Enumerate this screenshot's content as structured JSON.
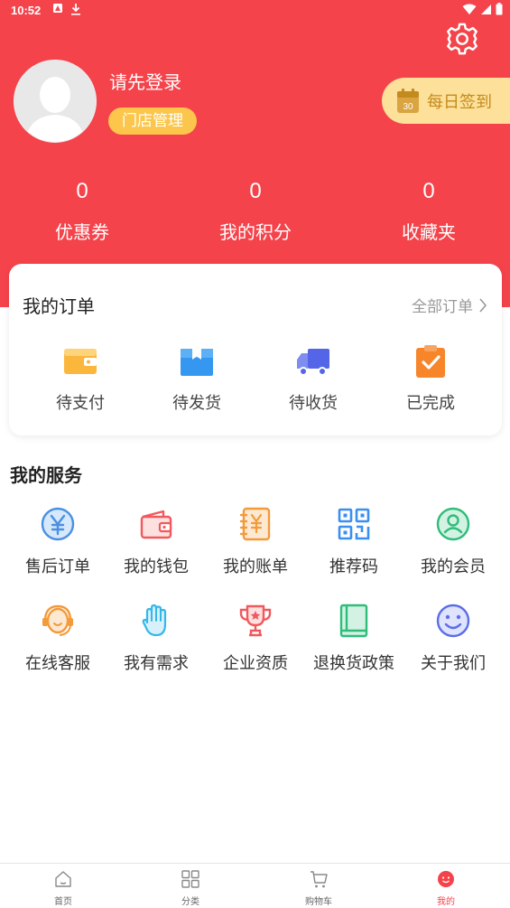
{
  "status_bar": {
    "time": "10:52"
  },
  "header": {
    "login_text": "请先登录",
    "store_button": "门店管理",
    "checkin_button": "每日签到",
    "checkin_day": "30",
    "stats": [
      {
        "value": "0",
        "label": "优惠券"
      },
      {
        "value": "0",
        "label": "我的积分"
      },
      {
        "value": "0",
        "label": "收藏夹"
      }
    ]
  },
  "orders": {
    "title": "我的订单",
    "all_link": "全部订单",
    "items": [
      {
        "label": "待支付",
        "icon": "wallet-icon",
        "color": "#fbb63c"
      },
      {
        "label": "待发货",
        "icon": "box-icon",
        "color": "#3597f0"
      },
      {
        "label": "待收货",
        "icon": "truck-icon",
        "color": "#5465e8"
      },
      {
        "label": "已完成",
        "icon": "clipboard-check-icon",
        "color": "#f7852a"
      }
    ]
  },
  "services": {
    "title": "我的服务",
    "items": [
      {
        "label": "售后订单",
        "icon": "yen-circle-icon",
        "color": "#4a90e2"
      },
      {
        "label": "我的钱包",
        "icon": "wallet-outline-icon",
        "color": "#f0595d"
      },
      {
        "label": "我的账单",
        "icon": "bill-icon",
        "color": "#f49a3b"
      },
      {
        "label": "推荐码",
        "icon": "qr-code-icon",
        "color": "#3b8ff0"
      },
      {
        "label": "我的会员",
        "icon": "member-icon",
        "color": "#2ebd7a"
      },
      {
        "label": "在线客服",
        "icon": "headset-icon",
        "color": "#f49a3b"
      },
      {
        "label": "我有需求",
        "icon": "hand-icon",
        "color": "#35b8e8"
      },
      {
        "label": "企业资质",
        "icon": "trophy-icon",
        "color": "#f0595d"
      },
      {
        "label": "退换货政策",
        "icon": "book-icon",
        "color": "#2ebd7a"
      },
      {
        "label": "关于我们",
        "icon": "smile-icon",
        "color": "#5b6ee8"
      }
    ]
  },
  "tabbar": {
    "items": [
      {
        "label": "首页",
        "icon": "home-icon"
      },
      {
        "label": "分类",
        "icon": "grid-icon"
      },
      {
        "label": "购物车",
        "icon": "cart-icon"
      },
      {
        "label": "我的",
        "icon": "profile-icon",
        "active": true
      }
    ]
  },
  "colors": {
    "brand_red": "#f5434b",
    "gold": "#fbc64b"
  }
}
